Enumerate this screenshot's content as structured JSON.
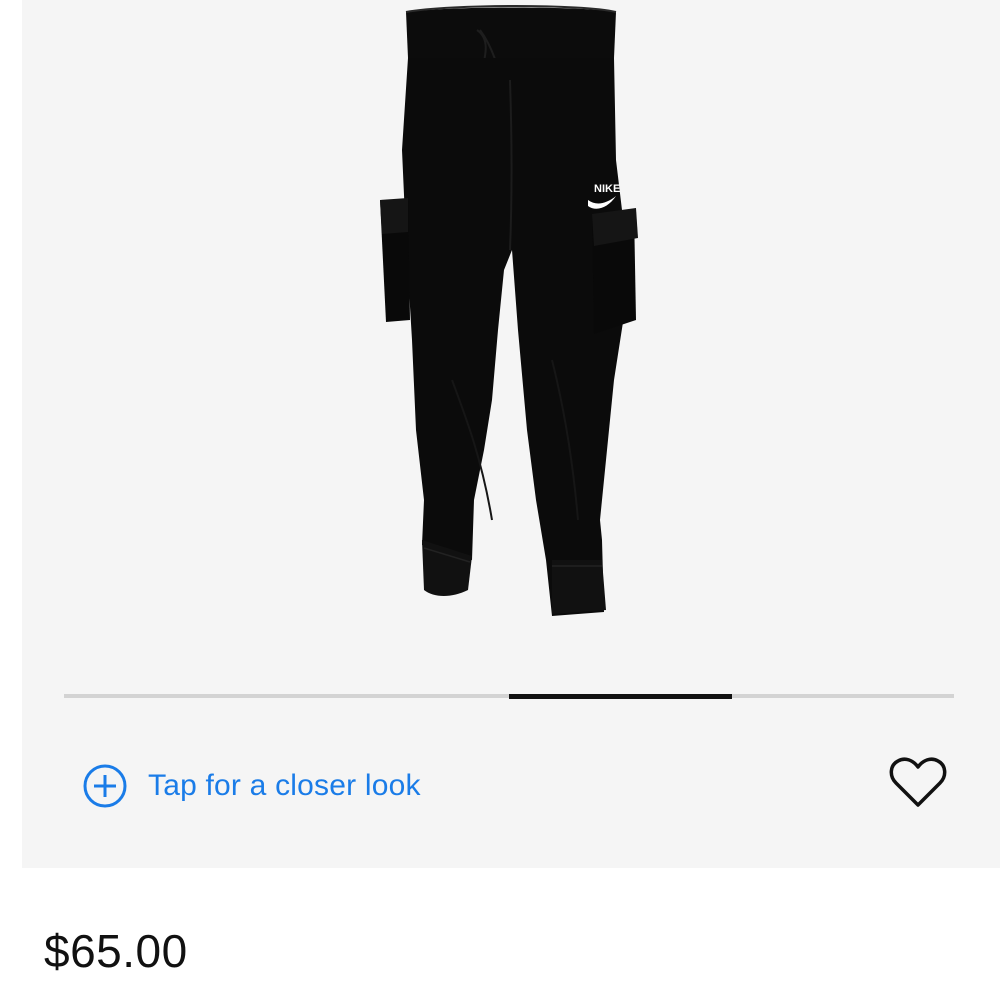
{
  "product": {
    "image_alt": "Black cargo jogger pants",
    "logo_text": "NIKE",
    "price": "$65.00"
  },
  "gallery": {
    "closer_look_label": "Tap for a closer look",
    "carousel_position": {
      "start": 0.5,
      "end": 0.75
    }
  },
  "icons": {
    "zoom": "plus-circle-icon",
    "favorite": "heart-outline-icon"
  },
  "colors": {
    "accent": "#1a7ce8",
    "background": "#f5f5f5",
    "indicator": "#111111"
  }
}
